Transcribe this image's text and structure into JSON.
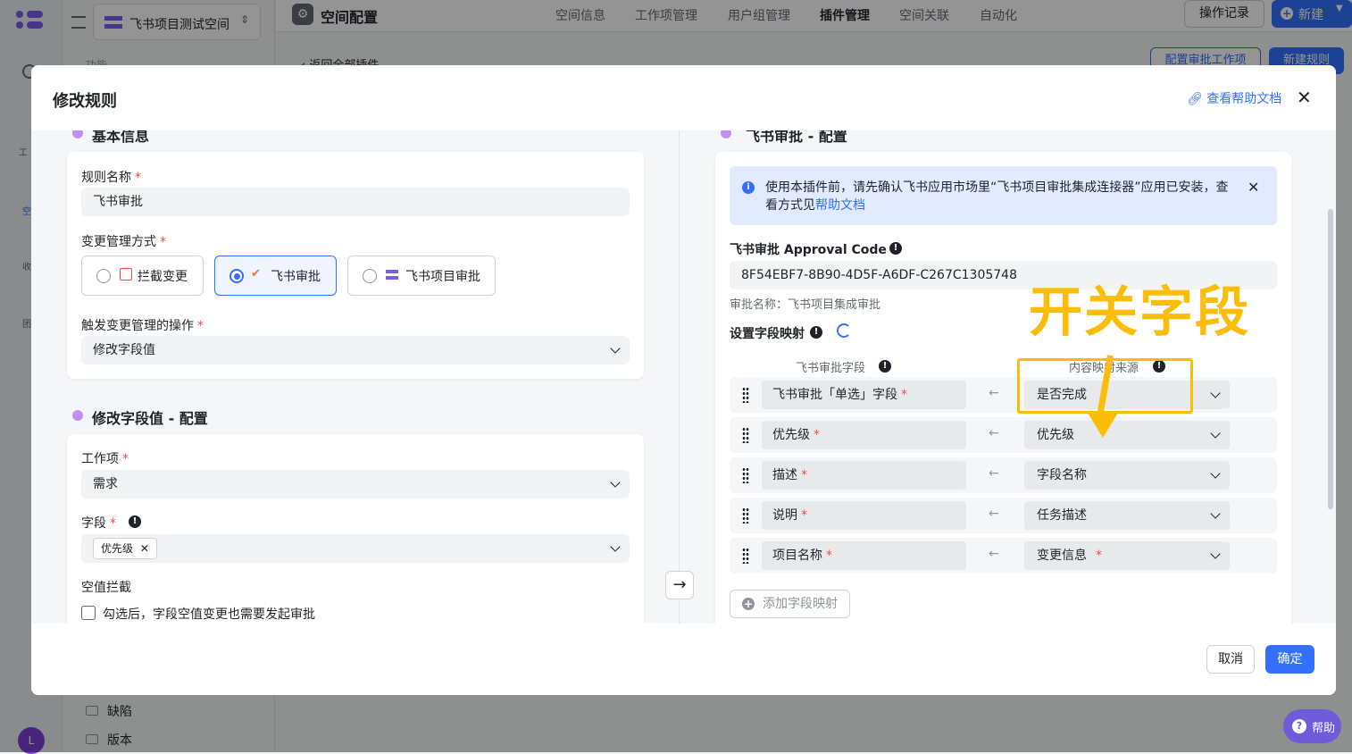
{
  "app": {
    "workspace_name": "飞书项目测试空间",
    "page_title": "空间配置",
    "tabs": [
      "空间信息",
      "工作项管理",
      "用户组管理",
      "插件管理",
      "空间关联",
      "自动化"
    ],
    "active_tab": "插件管理",
    "op_log_label": "操作记录",
    "new_label": "新建",
    "back_label": "返回全部插件",
    "config_label": "配置审批工作项",
    "new_rule_label": "新建规则",
    "side_section": "功能",
    "rail_labels": [
      "工",
      "空",
      "收",
      "团"
    ],
    "side_items": [
      "缺陷",
      "版本"
    ],
    "avatar_letter": "L",
    "help_label": "帮助",
    "accent": "#3370ff"
  },
  "modal": {
    "title": "修改规则",
    "help_doc_label": "查看帮助文档",
    "basic": {
      "title": "基本信息",
      "rule_name_label": "规则名称",
      "rule_name_value": "飞书审批",
      "mode_label": "变更管理方式",
      "options": [
        "拦截变更",
        "飞书审批",
        "飞书项目审批"
      ],
      "selected_option": "飞书审批",
      "trigger_label": "触发变更管理的操作",
      "trigger_value": "修改字段值"
    },
    "modify": {
      "title": "修改字段值 - 配置",
      "work_item_label": "工作项",
      "work_item_value": "需求",
      "field_label": "字段",
      "field_tag": "优先级",
      "empty_label": "空值拦截",
      "empty_checkbox_text": "勾选后，字段空值变更也需要发起审批",
      "empty_checked": false
    },
    "approval": {
      "title": "飞书审批 - 配置",
      "notice_text": "使用本插件前，请先确认飞书应用市场里“飞书项目审批集成连接器”应用已安装，查看方式见",
      "notice_link": "帮助文档",
      "code_label": "飞书审批 Approval Code",
      "code_value": "8F54EBF7-8B90-4D5F-A6DF-C267C1305748",
      "approval_name_text": "审批名称：飞书项目集成审批",
      "mapping_label": "设置字段映射",
      "col_left": "飞书审批字段",
      "col_right": "内容映射来源",
      "rows": [
        {
          "left": "飞书审批「单选」字段",
          "right": "是否完成",
          "right_req": false
        },
        {
          "left": "优先级",
          "right": "优先级",
          "right_req": false
        },
        {
          "left": "描述",
          "right": "字段名称",
          "right_req": false
        },
        {
          "left": "说明",
          "right": "任务描述",
          "right_req": false
        },
        {
          "left": "项目名称",
          "right": "变更信息",
          "right_req": true
        }
      ],
      "add_mapping_label": "添加字段映射"
    },
    "annotation_text": "开关字段",
    "cancel_label": "取消",
    "ok_label": "确定"
  }
}
